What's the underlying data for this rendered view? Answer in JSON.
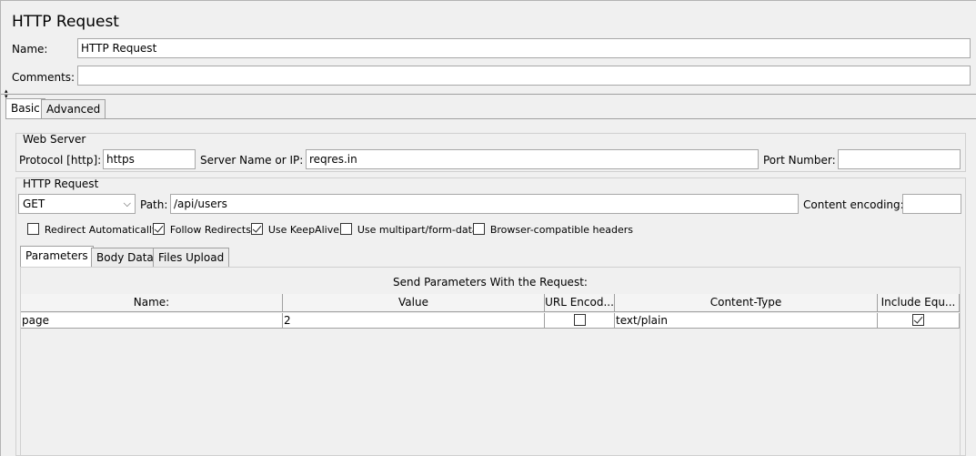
{
  "title": "HTTP Request",
  "name_label": "Name:",
  "name_value": "HTTP Request",
  "comments_label": "Comments:",
  "comments_value": "",
  "tabs": [
    {
      "label": "Basic",
      "active": true
    },
    {
      "label": "Advanced",
      "active": false
    }
  ],
  "web_server": {
    "title": "Web Server",
    "protocol_label": "Protocol [http]:",
    "protocol_value": "https",
    "server_label": "Server Name or IP:",
    "server_value": "reqres.in",
    "port_label": "Port Number:",
    "port_value": ""
  },
  "http_request": {
    "title": "HTTP Request",
    "method": "GET",
    "path_label": "Path:",
    "path_value": "/api/users",
    "encoding_label": "Content encoding:",
    "encoding_value": "",
    "checkboxes": [
      {
        "label": "Redirect Automatically",
        "checked": false
      },
      {
        "label": "Follow Redirects",
        "checked": true
      },
      {
        "label": "Use KeepAlive",
        "checked": true
      },
      {
        "label": "Use multipart/form-data",
        "checked": false
      },
      {
        "label": "Browser-compatible headers",
        "checked": false
      }
    ]
  },
  "param_tabs": [
    {
      "label": "Parameters",
      "active": true
    },
    {
      "label": "Body Data",
      "active": false
    },
    {
      "label": "Files Upload",
      "active": false
    }
  ],
  "params": {
    "caption": "Send Parameters With the Request:",
    "columns": [
      "Name:",
      "Value",
      "URL Encod...",
      "Content-Type",
      "Include Equ..."
    ],
    "rows": [
      {
        "name": "page",
        "value": "2",
        "url_encode": false,
        "content_type": "text/plain",
        "include_equals": true
      }
    ]
  }
}
